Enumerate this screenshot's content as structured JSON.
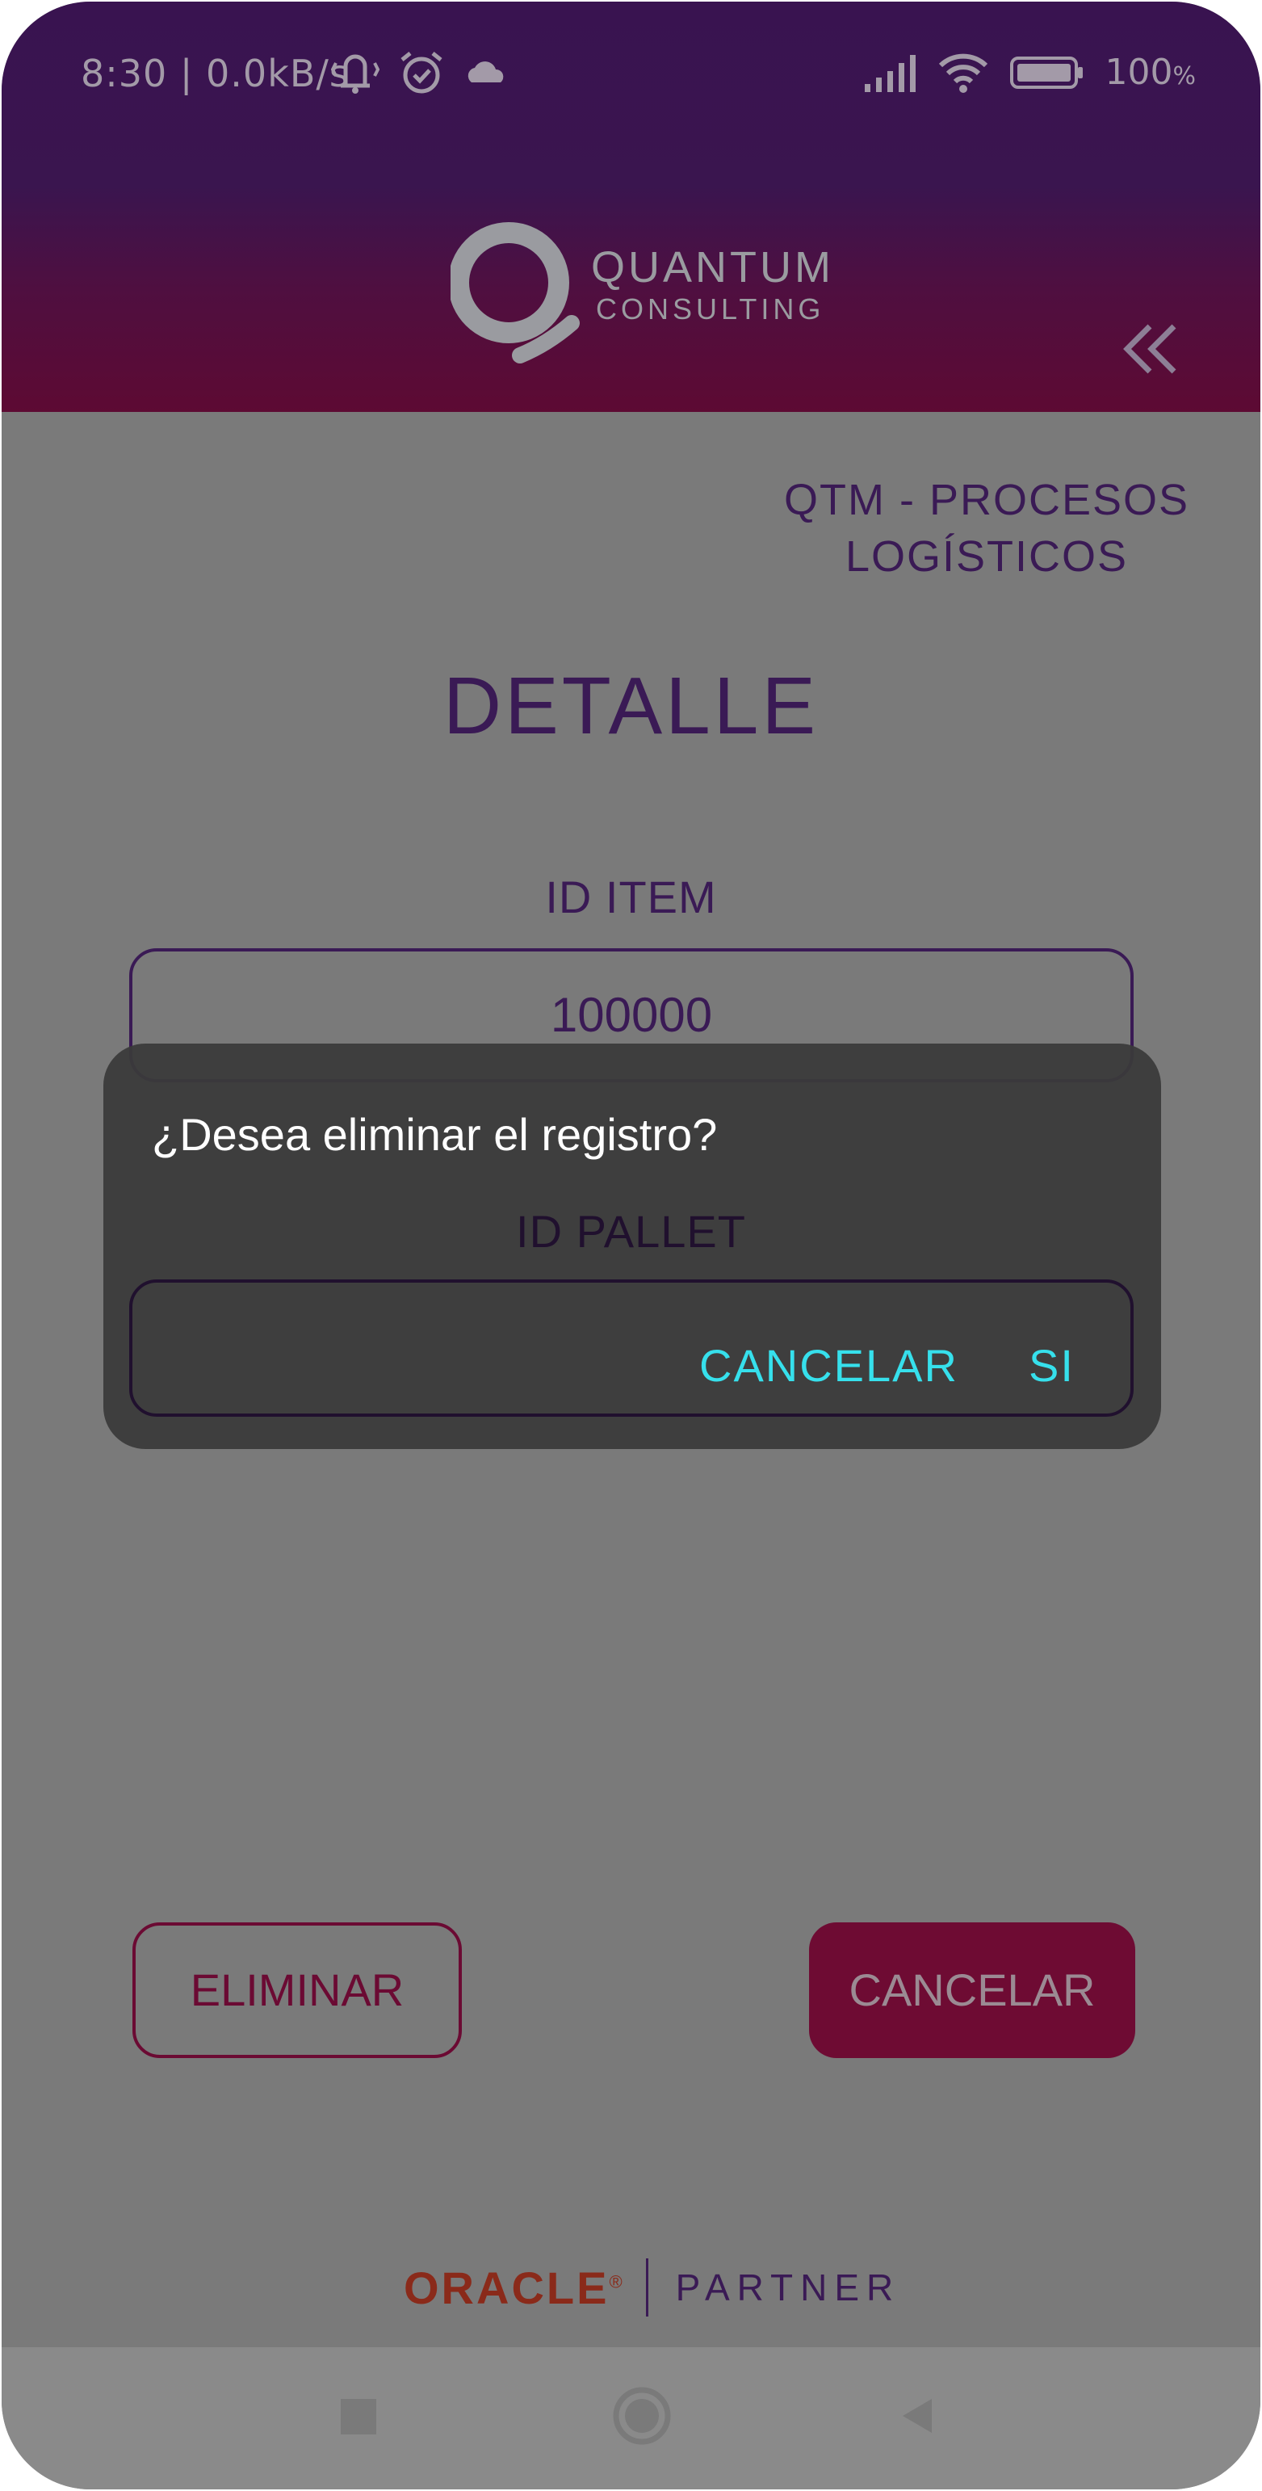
{
  "status_bar": {
    "time_speed": "8:30 | 0.0kB/s",
    "battery": "100",
    "battery_unit": "%",
    "icons": [
      "vibrate-icon",
      "alarm-icon",
      "cloud-icon",
      "signal-icon",
      "wifi-icon",
      "battery-icon"
    ]
  },
  "header": {
    "logo_line1": "QUANTUM",
    "logo_line2": "CONSULTING",
    "back_icon": "double-chevron-left-icon"
  },
  "app_title": {
    "line1": "QTM - PROCESOS",
    "line2": "LOGÍSTICOS"
  },
  "page_title": "DETALLE",
  "fields": {
    "item_label": "ID ITEM",
    "item_value": "100000",
    "pallet_label": "ID PALLET",
    "pallet_value": ""
  },
  "buttons": {
    "delete": "ELIMINAR",
    "cancel": "CANCELAR"
  },
  "dialog": {
    "message": "¿Desea eliminar el registro?",
    "cancel": "CANCELAR",
    "confirm": "SI"
  },
  "footer": {
    "oracle": "ORACLE",
    "registered": "®",
    "partner": "PARTNER"
  },
  "colors": {
    "header_top": "#391350",
    "header_bottom": "#5d0a33",
    "brand_purple": "#3a1a55",
    "brand_wine": "#6e0b33",
    "dialog_accent": "#36e0ec",
    "overlay": "#7a7a7a"
  },
  "nav_bar": {
    "icons": [
      "square-icon",
      "circle-home-icon",
      "triangle-back-icon"
    ]
  }
}
